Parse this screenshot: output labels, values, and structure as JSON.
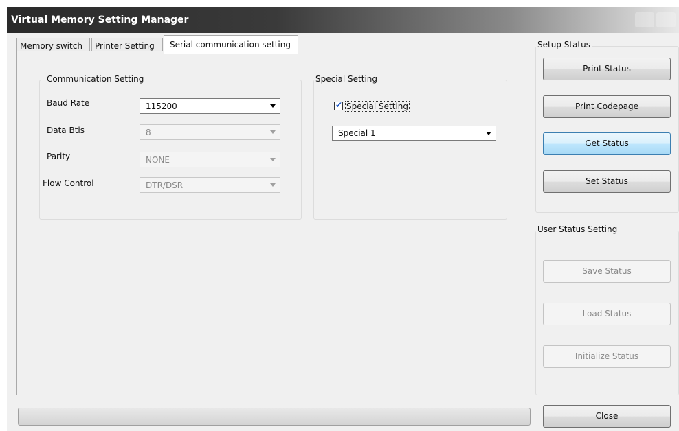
{
  "window": {
    "title": "Virtual Memory Setting Manager"
  },
  "tabs": [
    {
      "label": "Memory switch",
      "active": false
    },
    {
      "label": "Printer Setting",
      "active": false
    },
    {
      "label": "Serial communication setting",
      "active": true
    }
  ],
  "communication": {
    "title": "Communication Setting",
    "fields": [
      {
        "label": "Baud Rate",
        "value": "115200",
        "enabled": true
      },
      {
        "label": "Data Btis",
        "value": "8",
        "enabled": false
      },
      {
        "label": "Parity",
        "value": "NONE",
        "enabled": false
      },
      {
        "label": "Flow Control",
        "value": "DTR/DSR",
        "enabled": false
      }
    ]
  },
  "special": {
    "title": "Special Setting",
    "checkbox_label": "Special Setting",
    "checked": true,
    "select_value": "Special 1"
  },
  "setup_status": {
    "title": "Setup Status",
    "buttons": [
      {
        "label": "Print Status"
      },
      {
        "label": "Print Codepage"
      },
      {
        "label": "Get Status"
      },
      {
        "label": "Set Status"
      }
    ]
  },
  "user_status": {
    "title": "User Status Setting",
    "buttons": [
      {
        "label": "Save Status"
      },
      {
        "label": "Load Status"
      },
      {
        "label": "Initialize Status"
      }
    ]
  },
  "progress": {
    "value": 0
  },
  "close_label": "Close"
}
